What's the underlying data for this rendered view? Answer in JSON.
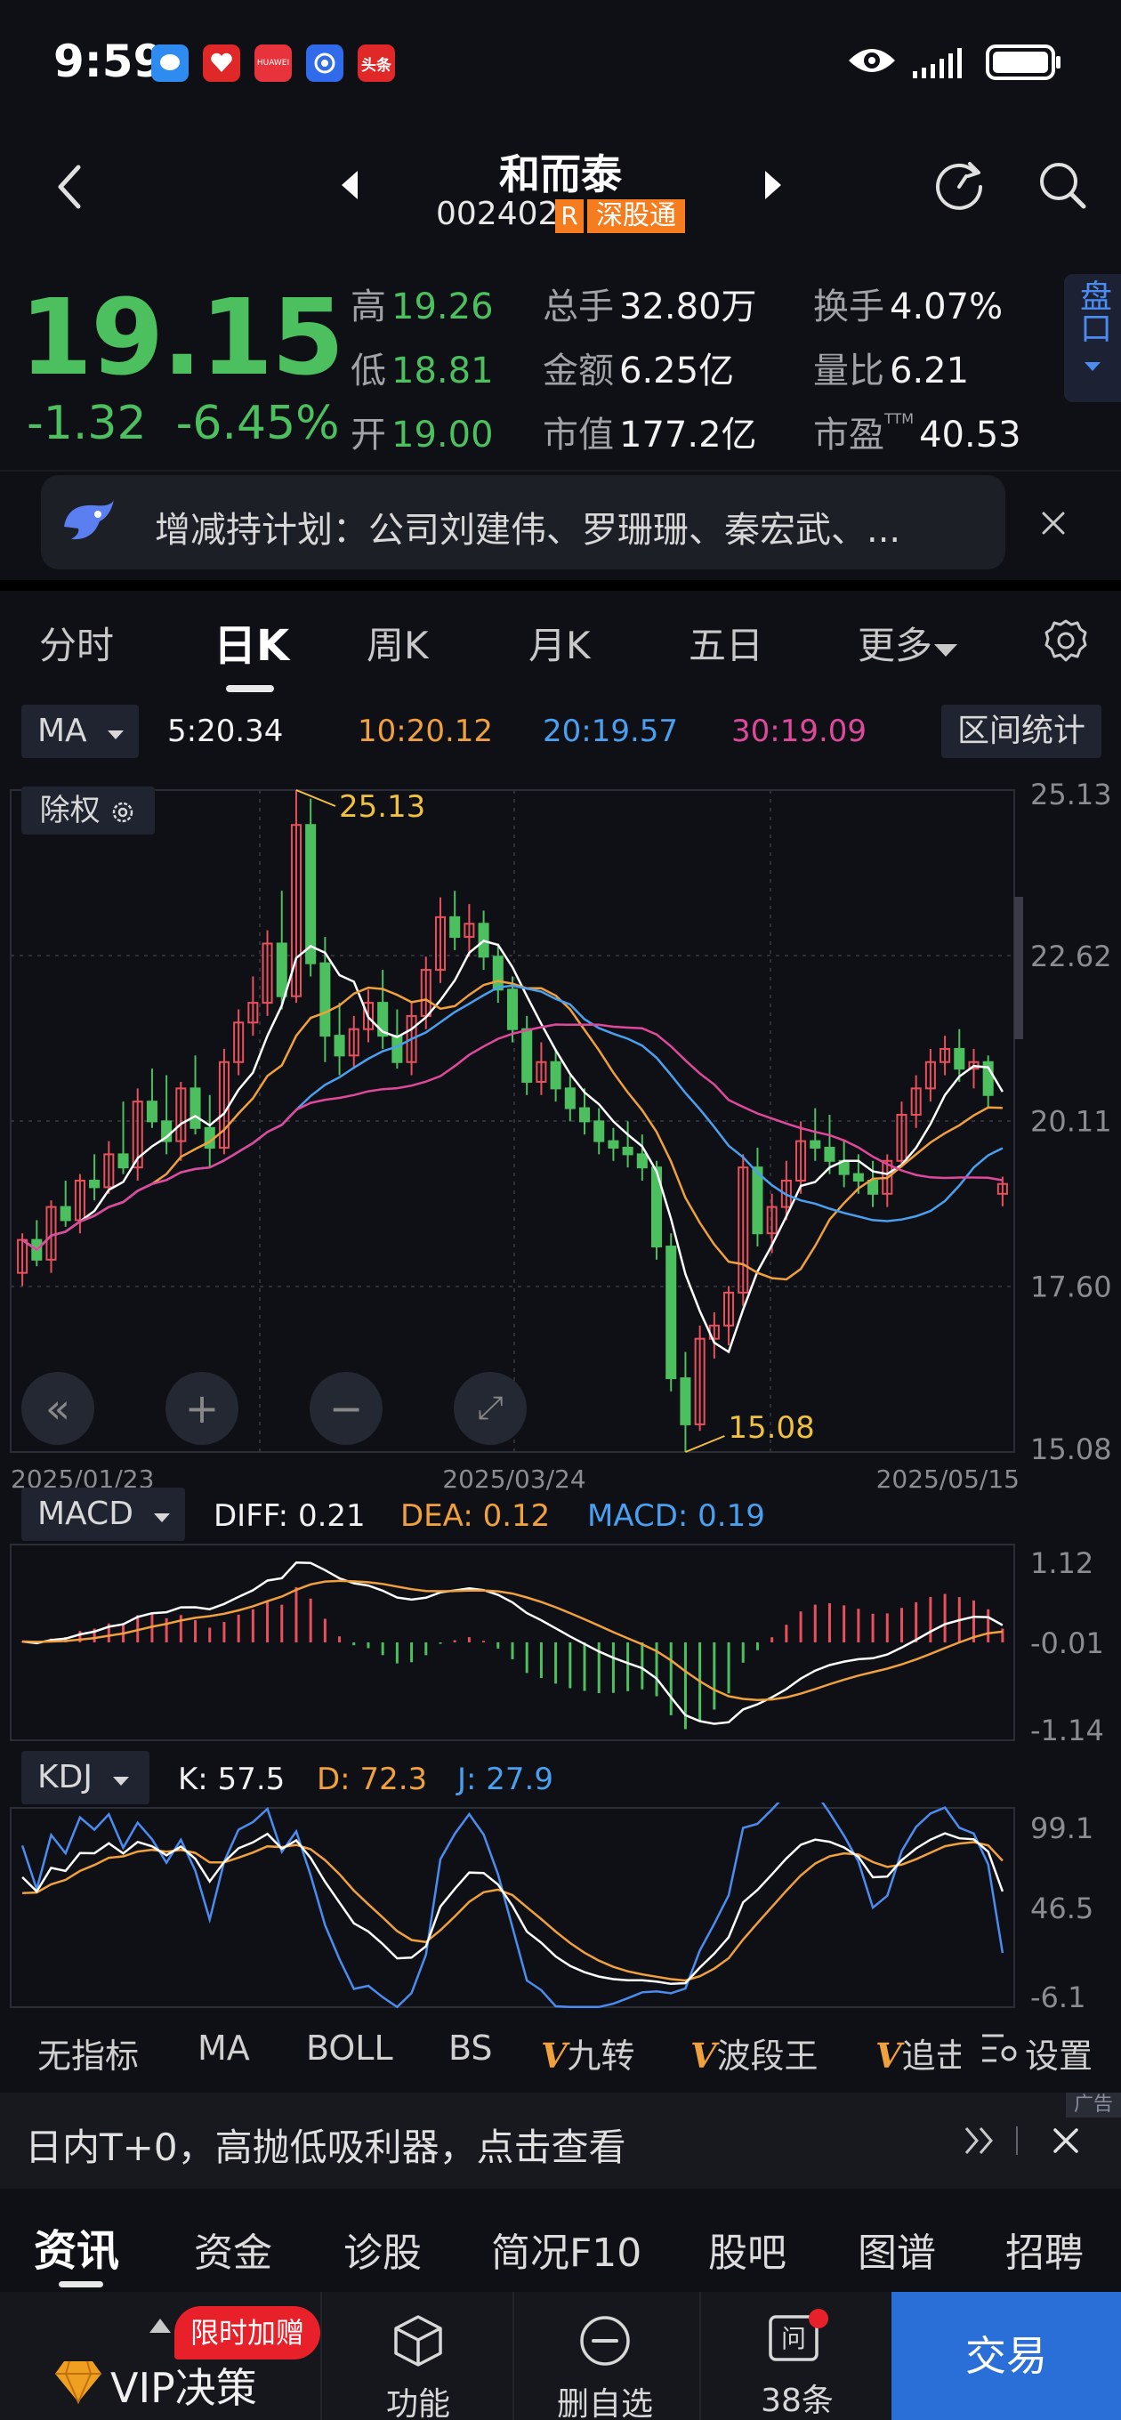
{
  "status_bar": {
    "time": "9:59",
    "apps": [
      "chat-app",
      "vmall-app",
      "huawei-app",
      "assistant-app",
      "toutiao-app"
    ],
    "app_labels": {
      "huawei": "HUAWEI",
      "toutiao": "头条"
    }
  },
  "header": {
    "stock_name": "和而泰",
    "stock_code": "002402",
    "tag_r": "R",
    "tag_market": "深股通"
  },
  "quote": {
    "price": "19.15",
    "change": "-1.32",
    "change_pct": "-6.45%",
    "rows": [
      [
        {
          "label": "高",
          "value": "19.26",
          "color": "green"
        },
        {
          "label": "总手",
          "value": "32.80万",
          "color": "white"
        },
        {
          "label": "换手",
          "value": "4.07%",
          "color": "white"
        }
      ],
      [
        {
          "label": "低",
          "value": "18.81",
          "color": "green"
        },
        {
          "label": "金额",
          "value": "6.25亿",
          "color": "white"
        },
        {
          "label": "量比",
          "value": "6.21",
          "color": "white"
        }
      ],
      [
        {
          "label": "开",
          "value": "19.00",
          "color": "green"
        },
        {
          "label": "市值",
          "value": "177.2亿",
          "color": "white"
        },
        {
          "label": "市盈",
          "value": "40.53",
          "color": "white",
          "sup": "TTM"
        }
      ]
    ],
    "pankou_label": "盘口"
  },
  "notice": {
    "text": "增减持计划：公司刘建伟、罗珊珊、秦宏武、..."
  },
  "chart_tabs": [
    "分时",
    "日K",
    "周K",
    "月K",
    "五日",
    "更多"
  ],
  "active_tab": "日K",
  "ma_bar": {
    "selector": "MA",
    "ma5": "5:20.34",
    "ma10": "10:20.12",
    "ma20": "20:19.57",
    "ma30": "30:19.09",
    "range_stats": "区间统计",
    "chuquan": "除权"
  },
  "chart_data": [
    {
      "type": "candlestick",
      "title": "",
      "yaxis_ticks": [
        "25.13",
        "22.62",
        "20.11",
        "17.60",
        "15.08"
      ],
      "ylim": [
        15.08,
        25.13
      ],
      "x_labels": [
        "2025/01/23",
        "2025/03/24",
        "2025/05/15"
      ],
      "max_annotation": "25.13",
      "min_annotation": "15.08",
      "candles": [
        [
          17.8,
          18.4,
          17.6,
          18.3
        ],
        [
          18.3,
          18.6,
          17.9,
          18.0
        ],
        [
          18.0,
          18.9,
          17.8,
          18.8
        ],
        [
          18.8,
          19.2,
          18.5,
          18.6
        ],
        [
          18.6,
          19.3,
          18.4,
          19.2
        ],
        [
          19.2,
          19.6,
          18.9,
          19.1
        ],
        [
          19.1,
          19.8,
          19.0,
          19.6
        ],
        [
          19.6,
          20.4,
          19.3,
          19.4
        ],
        [
          19.4,
          20.6,
          19.2,
          20.4
        ],
        [
          20.4,
          20.9,
          20.0,
          20.1
        ],
        [
          20.1,
          20.8,
          19.6,
          19.8
        ],
        [
          19.8,
          20.7,
          19.5,
          20.6
        ],
        [
          20.6,
          21.1,
          19.9,
          20.0
        ],
        [
          20.0,
          20.5,
          19.4,
          19.7
        ],
        [
          19.7,
          21.2,
          19.6,
          21.0
        ],
        [
          21.0,
          21.8,
          20.8,
          21.6
        ],
        [
          21.6,
          22.3,
          21.4,
          21.9
        ],
        [
          21.9,
          23.0,
          21.7,
          22.8
        ],
        [
          22.8,
          23.6,
          21.8,
          22.0
        ],
        [
          22.0,
          25.13,
          21.9,
          24.6
        ],
        [
          24.6,
          25.0,
          22.3,
          22.5
        ],
        [
          22.5,
          22.9,
          21.0,
          21.4
        ],
        [
          21.4,
          21.9,
          20.8,
          21.1
        ],
        [
          21.1,
          21.7,
          20.9,
          21.5
        ],
        [
          21.5,
          22.1,
          21.3,
          21.9
        ],
        [
          21.9,
          22.4,
          21.2,
          21.4
        ],
        [
          21.4,
          21.8,
          20.9,
          21.0
        ],
        [
          21.0,
          21.9,
          20.8,
          21.7
        ],
        [
          21.7,
          22.6,
          21.5,
          22.4
        ],
        [
          22.4,
          23.5,
          22.2,
          23.2
        ],
        [
          23.2,
          23.6,
          22.7,
          22.9
        ],
        [
          22.9,
          23.4,
          22.6,
          23.1
        ],
        [
          23.1,
          23.3,
          22.4,
          22.6
        ],
        [
          22.6,
          22.8,
          21.9,
          22.1
        ],
        [
          22.1,
          22.3,
          21.3,
          21.5
        ],
        [
          21.5,
          21.7,
          20.5,
          20.7
        ],
        [
          20.7,
          21.3,
          20.5,
          21.0
        ],
        [
          21.0,
          21.2,
          20.4,
          20.6
        ],
        [
          20.6,
          20.8,
          20.1,
          20.3
        ],
        [
          20.3,
          20.6,
          19.9,
          20.1
        ],
        [
          20.1,
          20.3,
          19.6,
          19.8
        ],
        [
          19.8,
          20.0,
          19.5,
          19.7
        ],
        [
          19.7,
          20.1,
          19.4,
          19.6
        ],
        [
          19.6,
          19.9,
          19.2,
          19.4
        ],
        [
          19.4,
          19.5,
          18.0,
          18.2
        ],
        [
          18.2,
          18.4,
          16.0,
          16.2
        ],
        [
          16.2,
          16.6,
          15.08,
          15.5
        ],
        [
          15.5,
          17.0,
          15.4,
          16.8
        ],
        [
          16.8,
          17.2,
          16.5,
          17.0
        ],
        [
          17.0,
          17.6,
          16.7,
          17.5
        ],
        [
          17.5,
          19.6,
          17.3,
          19.4
        ],
        [
          19.4,
          19.7,
          18.2,
          18.4
        ],
        [
          18.4,
          19.0,
          18.1,
          18.8
        ],
        [
          18.8,
          19.5,
          18.6,
          19.2
        ],
        [
          19.2,
          20.1,
          19.0,
          19.8
        ],
        [
          19.8,
          20.3,
          19.5,
          19.7
        ],
        [
          19.7,
          20.2,
          19.3,
          19.5
        ],
        [
          19.5,
          19.8,
          19.1,
          19.3
        ],
        [
          19.3,
          19.6,
          19.0,
          19.2
        ],
        [
          19.2,
          19.5,
          18.8,
          19.0
        ],
        [
          19.0,
          19.6,
          18.8,
          19.5
        ],
        [
          19.5,
          20.4,
          19.4,
          20.2
        ],
        [
          20.2,
          20.8,
          20.0,
          20.6
        ],
        [
          20.6,
          21.2,
          20.4,
          21.0
        ],
        [
          21.0,
          21.4,
          20.8,
          21.2
        ],
        [
          21.2,
          21.5,
          20.7,
          20.9
        ],
        [
          20.9,
          21.2,
          20.6,
          21.0
        ],
        [
          21.0,
          21.1,
          20.3,
          20.5
        ],
        [
          19.0,
          19.26,
          18.81,
          19.15
        ]
      ]
    },
    {
      "type": "line",
      "title": "MACD",
      "series_labels": {
        "diff": "DIFF: 0.21",
        "dea": "DEA: 0.12",
        "macd": "MACD: 0.19"
      },
      "yaxis_ticks": [
        "1.12",
        "-0.01",
        "-1.14"
      ],
      "ylim": [
        -1.14,
        1.12
      ]
    },
    {
      "type": "line",
      "title": "KDJ",
      "series_labels": {
        "k": "K: 57.5",
        "d": "D: 72.3",
        "j": "J: 27.9"
      },
      "yaxis_ticks": [
        "99.1",
        "46.5",
        "-6.1"
      ],
      "ylim": [
        -6.1,
        99.1
      ]
    }
  ],
  "indicator_row": {
    "items": [
      "无指标",
      "MA",
      "BOLL",
      "BS",
      "九转",
      "波段王",
      "追击"
    ],
    "settings": "设置",
    "active": "MA"
  },
  "ad": {
    "tag": "广告",
    "text": "日内T+0，高抛低吸利器，点击查看"
  },
  "bottom_tabs": [
    "资讯",
    "资金",
    "诊股",
    "简况F10",
    "股吧",
    "图谱",
    "招聘"
  ],
  "footer": {
    "vip_badge": "限时加赠",
    "vip_label": "VIP决策",
    "func": "功能",
    "remove": "删自选",
    "ask_icon_text": "问",
    "ask": "38条",
    "trade": "交易"
  },
  "colors": {
    "up": "#e8505b",
    "down": "#4cc05f",
    "ma5": "#ffffff",
    "ma10": "#f0a03c",
    "ma20": "#4aa0f0",
    "ma30": "#e0489c",
    "trade_btn": "#2a6fd8"
  }
}
